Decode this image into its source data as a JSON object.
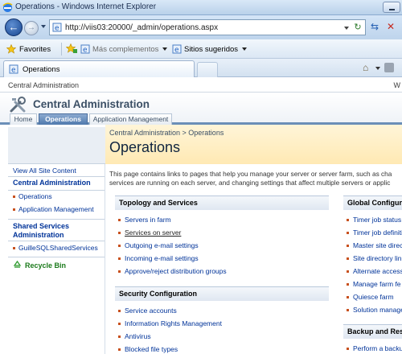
{
  "window": {
    "title": "Operations - Windows Internet Explorer"
  },
  "address": {
    "url": "http://viis03:20000/_admin/operations.aspx"
  },
  "favorites_bar": {
    "favorites_label": "Favorites",
    "mas_label": "Más complementos",
    "sitios_label": "Sitios sugeridos"
  },
  "tab": {
    "label": "Operations"
  },
  "sharepoint": {
    "top_crumb": "Central Administration",
    "user_initial": "W",
    "site_title": "Central Administration",
    "nav_tabs": [
      "Home",
      "Operations",
      "Application Management"
    ]
  },
  "left_nav": {
    "view_all": "View All Site Content",
    "central_admin_head": "Central Administration",
    "central_admin_items": [
      "Operations",
      "Application Management"
    ],
    "ssp_head": "Shared Services Administration",
    "ssp_items": [
      "GuilleSQLSharedServices"
    ],
    "recycle_bin": "Recycle Bin"
  },
  "content": {
    "breadcrumb": "Central Administration > Operations",
    "page_title": "Operations",
    "desc_line1": "This page contains links to pages that help you manage your server or server farm, such as cha",
    "desc_line2": "services are running on each server, and changing settings that affect multiple servers or applic"
  },
  "sections": {
    "topology": {
      "head": "Topology and Services",
      "links": [
        "Servers in farm",
        "Services on server",
        "Outgoing e-mail settings",
        "Incoming e-mail settings",
        "Approve/reject distribution groups"
      ]
    },
    "security": {
      "head": "Security Configuration",
      "links": [
        "Service accounts",
        "Information Rights Management",
        "Antivirus",
        "Blocked file types"
      ]
    },
    "global": {
      "head": "Global Configuration",
      "links": [
        "Timer job status",
        "Timer job definitions",
        "Master site directory",
        "Site directory links",
        "Alternate access",
        "Manage farm fe",
        "Quiesce farm",
        "Solution manage"
      ]
    },
    "backup": {
      "head": "Backup and Res",
      "links": [
        "Perform a backup"
      ]
    }
  }
}
